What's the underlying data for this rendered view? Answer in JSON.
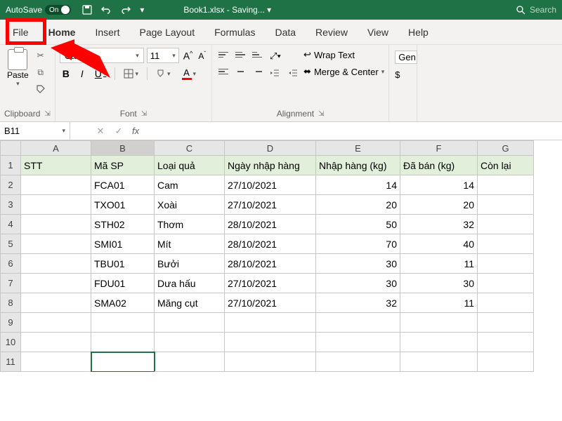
{
  "titlebar": {
    "autosave_label": "AutoSave",
    "autosave_state": "On",
    "document_title": "Book1.xlsx - Saving... ▾",
    "search_placeholder": "Search"
  },
  "tabs": [
    "File",
    "Home",
    "Insert",
    "Page Layout",
    "Formulas",
    "Data",
    "Review",
    "View",
    "Help"
  ],
  "active_tab": "Home",
  "ribbon": {
    "clipboard": {
      "paste_label": "Paste",
      "title": "Clipboard"
    },
    "font": {
      "title": "Font",
      "font_name": "Calibri",
      "font_size": "11",
      "bold": "B",
      "italic": "I",
      "underline": "U"
    },
    "alignment": {
      "title": "Alignment",
      "wrap_text": "Wrap Text",
      "merge_center": "Merge & Center"
    },
    "number": {
      "format": "Gen",
      "currency": "$"
    }
  },
  "name_box": "B11",
  "columns": [
    "A",
    "B",
    "C",
    "D",
    "E",
    "F",
    "G"
  ],
  "col_widths": [
    "cw-A",
    "cw-B",
    "cw-C",
    "cw-D",
    "cw-E",
    "cw-F",
    "cw-G"
  ],
  "header_row": [
    "STT",
    "Mã SP",
    "Loại quả",
    "Ngày nhập hàng",
    "Nhập hàng (kg)",
    "Đã bán (kg)",
    "Còn lại"
  ],
  "data_rows": [
    [
      "",
      "FCA01",
      "Cam",
      "27/10/2021",
      "14",
      "14",
      ""
    ],
    [
      "",
      "TXO01",
      "Xoài",
      "27/10/2021",
      "20",
      "20",
      ""
    ],
    [
      "",
      "STH02",
      "Thơm",
      "28/10/2021",
      "50",
      "32",
      ""
    ],
    [
      "",
      "SMI01",
      "Mít",
      "28/10/2021",
      "70",
      "40",
      ""
    ],
    [
      "",
      "TBU01",
      "Bưởi",
      "28/10/2021",
      "30",
      "11",
      ""
    ],
    [
      "",
      "FDU01",
      "Dưa hấu",
      "27/10/2021",
      "30",
      "30",
      ""
    ],
    [
      "",
      "SMA02",
      "Măng cụt",
      "27/10/2021",
      "32",
      "11",
      ""
    ]
  ],
  "visible_row_numbers": [
    "1",
    "2",
    "3",
    "4",
    "5",
    "6",
    "7",
    "8",
    "9",
    "10",
    "11"
  ],
  "selected_cell": {
    "row": 11,
    "col": "B"
  },
  "numeric_columns": [
    "E",
    "F"
  ]
}
